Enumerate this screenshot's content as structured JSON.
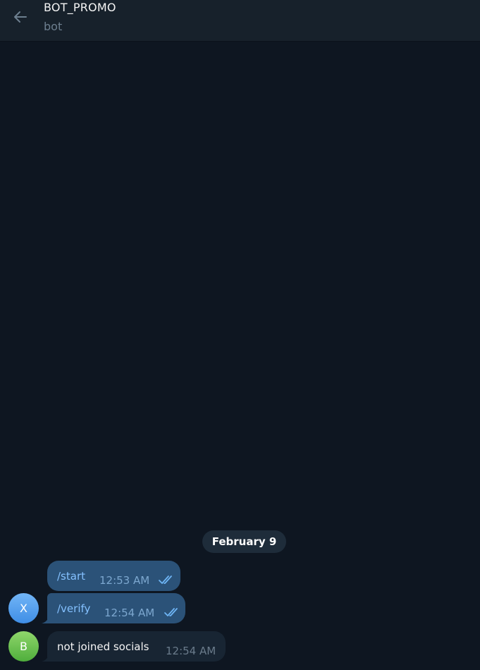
{
  "header": {
    "title": "BOT_PROMO",
    "subtitle": "bot"
  },
  "date_separator": "February 9",
  "messages": [
    {
      "text": "/start",
      "time": "12:53 AM",
      "direction": "outgoing",
      "status": "read"
    },
    {
      "text": "/verify",
      "time": "12:54 AM",
      "direction": "outgoing",
      "status": "read",
      "avatar": "X"
    },
    {
      "text": "not joined socials",
      "time": "12:54 AM",
      "direction": "incoming",
      "avatar": "B"
    }
  ],
  "icons": {
    "back": "arrow-left-icon",
    "read_status": "double-check-icon"
  },
  "colors": {
    "background": "#0e1621",
    "header": "#17212b",
    "outgoing_bubble": "#2b5278",
    "incoming_bubble": "#182533",
    "accent": "#84c1ff",
    "avatar_x": "#4f9fee",
    "avatar_b": "#6cc04f"
  }
}
